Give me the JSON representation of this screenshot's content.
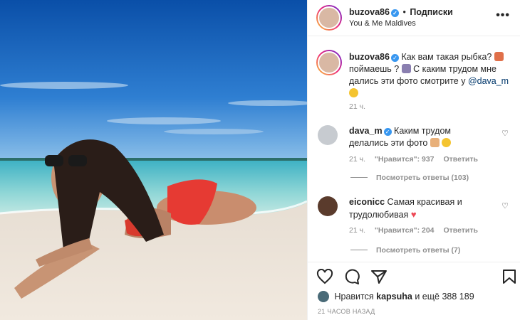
{
  "header": {
    "username": "buzova86",
    "dot": "•",
    "follow": "Подписки",
    "location": "You & Me Maldives",
    "more": "•••"
  },
  "caption": {
    "username": "buzova86",
    "text_1": "Как вам такая рыбка?",
    "text_2": "поймаешь ?",
    "text_3": "С каким трудом мне дались эти фото смотрите у",
    "mention": "@dava_m",
    "time": "21 ч."
  },
  "comments": [
    {
      "username": "dava_m",
      "text": "Каким трудом делались эти фото",
      "time": "21 ч.",
      "likes": "\"Нравится\": 937",
      "reply": "Ответить",
      "view_replies": "Посмотреть ответы (103)"
    },
    {
      "username": "eiconicc",
      "text": "Самая красивая и трудолюбивая",
      "time": "21 ч.",
      "likes": "\"Нравится\": 204",
      "reply": "Ответить",
      "view_replies": "Посмотреть ответы (7)"
    }
  ],
  "footer": {
    "likes_prefix": "Нравится",
    "likes_user": "kapsuha",
    "likes_suffix": "и ещё 388 189",
    "time_ago": "21 ЧАСОВ НАЗАД"
  },
  "icons": [
    "heart-icon",
    "comment-icon",
    "share-icon",
    "bookmark-icon",
    "more-icon",
    "verified-icon"
  ],
  "colors": {
    "verified": "#3897f0",
    "mention": "#00376b",
    "muted": "#8e8e8e",
    "heart_red": "#ed4956"
  }
}
